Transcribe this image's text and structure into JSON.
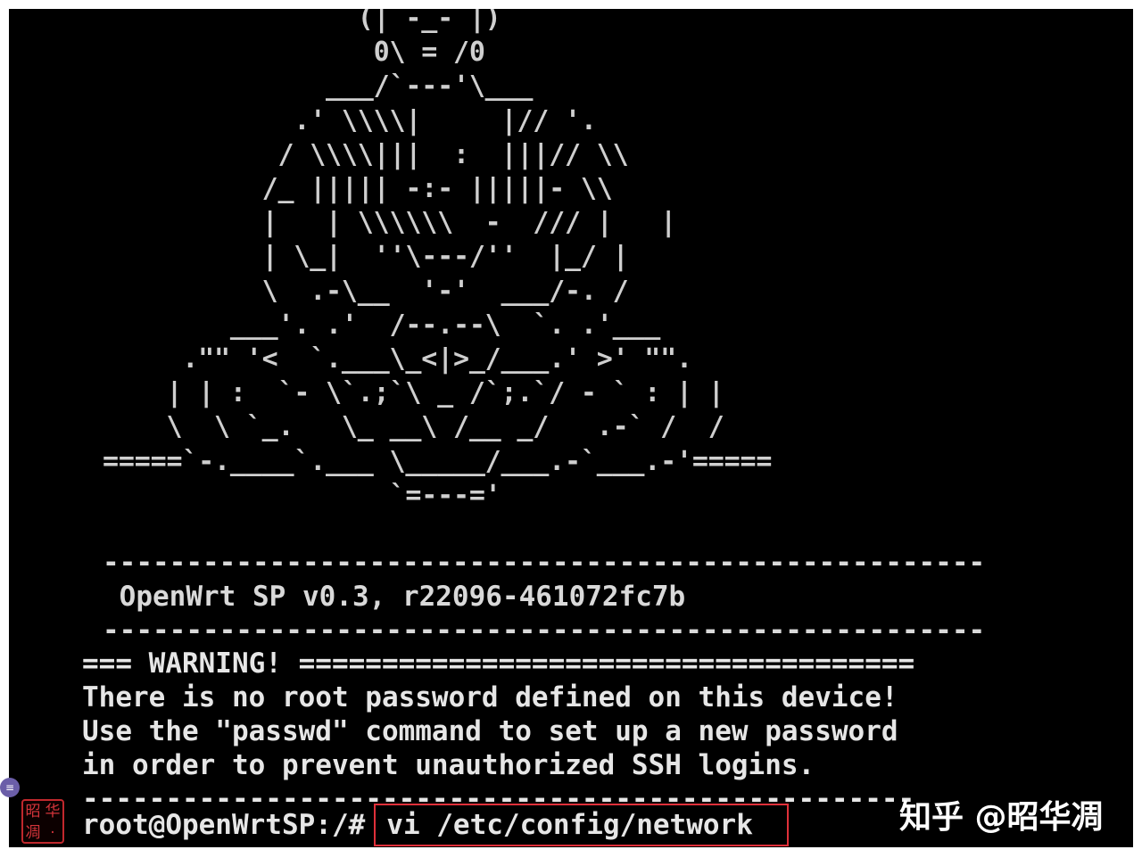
{
  "ascii_art": "                (| -_- |)\n                 0\\ = /0\n              ___/`---'\\___\n            .' \\\\\\\\|     |// '.\n           / \\\\\\\\|||  :  |||// \\\\\n          /_ ||||| -:- |||||- \\\\\n          |   | \\\\\\\\\\\\  -  /// |   |\n          | \\_|  ''\\---/''  |_/ |\n          \\  .-\\__  '-'  ___/-. /\n        ___'. .'  /--.--\\  `. .'___\n     .\"\" '<  `.___\\_<|>_/___.' >' \"\".\n    | | :  `- \\`.;`\\ _ /`;.`/ - ` : | |\n    \\  \\ `_.   \\_ __\\ /__ _/   .-` /  /\n=====`-.____`.___ \\_____/___.-`___.-'=====\n                  `=---='",
  "banner": {
    "separator_top": "-----------------------------------------------------",
    "version": " OpenWrt SP v0.3, r22096-461072fc7b",
    "separator_bottom": "-----------------------------------------------------"
  },
  "warning": {
    "header": "=== WARNING! =====================================",
    "line1": "There is no root password defined on this device!",
    "line2": "Use the \"passwd\" command to set up a new password",
    "line3": "in order to prevent unauthorized SSH logins.",
    "separator": "--------------------------------------------------"
  },
  "prompt": {
    "text": "root@OpenWrtSP:/#",
    "command": "vi /etc/config/network"
  },
  "overlay": {
    "badge": "≡",
    "seal_chars": [
      "昭",
      "华",
      "凋",
      "·"
    ],
    "watermark": "知乎 @昭华凋"
  },
  "colors": {
    "background": "#000000",
    "text": "#d9d9d9",
    "highlight_border": "#e0303a"
  }
}
